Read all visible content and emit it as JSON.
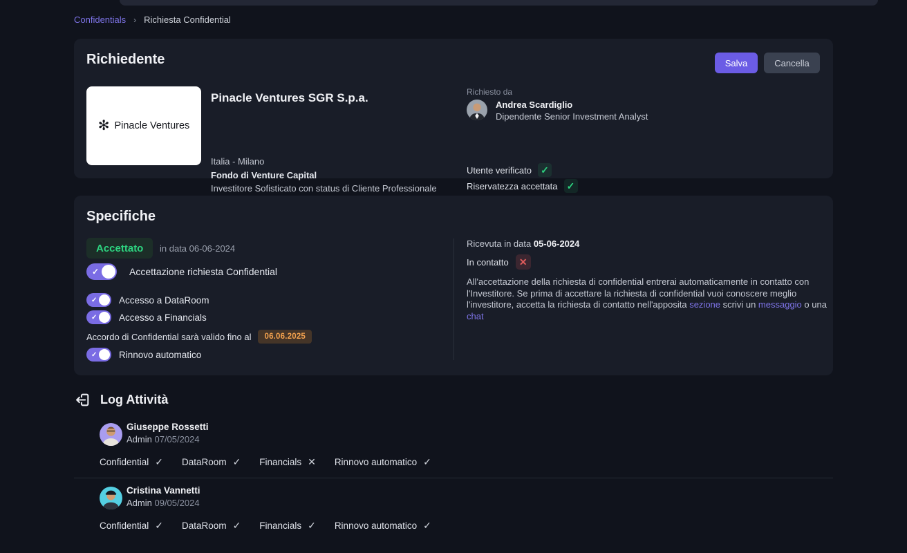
{
  "colors": {
    "background": "#10131c",
    "card": "#191d28",
    "accent_purple": "#6b5ce5",
    "toggle_purple": "#7a6ce4",
    "link_purple": "#7e74e8",
    "success_green": "#2dd480",
    "warning_orange": "#f2a14e",
    "danger_red": "#e25c5c"
  },
  "icons": {
    "check": "✓",
    "cross": "✕",
    "breadcrumb_chevron": "›",
    "logo_flower": "✻"
  },
  "breadcrumb": {
    "items": [
      {
        "label": "Confidentials"
      },
      {
        "label": "Richiesta Confidential"
      }
    ]
  },
  "richiedente": {
    "title": "Richiedente",
    "save_label": "Salva",
    "cancel_label": "Cancella",
    "company": {
      "logo_text": "Pinacle Ventures",
      "name": "Pinacle Ventures SGR S.p.a.",
      "location": "Italia - Milano",
      "fund_type": "Fondo di Venture Capital",
      "investor_status": "Investitore Sofisticato con status di Cliente Professionale"
    },
    "requested_by": {
      "label": "Richiesto da",
      "name": "Andrea Scardiglio",
      "role": "Dipendente Senior Investment Analyst",
      "checks": [
        {
          "label": "Utente verificato",
          "mark": "✓"
        },
        {
          "label": "Riservatezza accettata",
          "mark": "✓"
        }
      ]
    }
  },
  "specifiche": {
    "title": "Specifiche",
    "status_badge": "Accettato",
    "status_date_text": "in data 06-06-2024",
    "toggles": {
      "acceptance": {
        "label": "Accettazione richiesta Confidential",
        "on": true
      },
      "dataroom": {
        "label": "Accesso a DataRoom",
        "on": true
      },
      "financials": {
        "label": "Accesso a Financials",
        "on": true
      },
      "renewal": {
        "label": "Rinnovo automatico",
        "on": true
      }
    },
    "validity": {
      "label": "Accordo di Confidential sarà valido fino al",
      "date": "06.06.2025"
    },
    "received": {
      "label": "Ricevuta in data",
      "date": "05-06-2024"
    },
    "contact": {
      "label": "In contatto",
      "mark": "✕"
    },
    "note": {
      "part1": "All'accettazione della richiesta di confidential entrerai automaticamente in contatto con l'Investitore. Se prima di accettare la richiesta di confidential vuoi conoscere meglio l'investitore, accetta la richiesta di contatto nell'apposita ",
      "link1": "sezione",
      "part2": " scrivi un ",
      "link2": "messaggio",
      "part3": " o una ",
      "link3": "chat"
    }
  },
  "log": {
    "title": "Log Attività",
    "entries": [
      {
        "name": "Giuseppe Rossetti",
        "role": "Admin",
        "date": "07/05/2024",
        "statuses": [
          {
            "label": "Confidential",
            "mark": "✓"
          },
          {
            "label": "DataRoom",
            "mark": "✓"
          },
          {
            "label": "Financials",
            "mark": "✕"
          },
          {
            "label": "Rinnovo automatico",
            "mark": "✓"
          }
        ]
      },
      {
        "name": "Cristina Vannetti",
        "role": "Admin",
        "date": "09/05/2024",
        "statuses": [
          {
            "label": "Confidential",
            "mark": "✓"
          },
          {
            "label": "DataRoom",
            "mark": "✓"
          },
          {
            "label": "Financials",
            "mark": "✓"
          },
          {
            "label": "Rinnovo automatico",
            "mark": "✓"
          }
        ]
      }
    ]
  }
}
